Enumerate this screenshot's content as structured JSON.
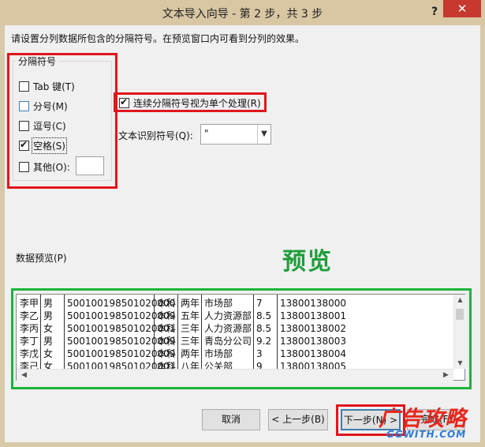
{
  "window": {
    "title": "文本导入向导 - 第 2 步，共 3 步",
    "help_label": "?",
    "close_label": "✕"
  },
  "instruction": "请设置分列数据所包含的分隔符号。在预览窗口内可看到分列的效果。",
  "delimiters": {
    "legend": "分隔符号",
    "tab": {
      "label": "Tab 键(T)",
      "checked": false
    },
    "semicolon": {
      "label": "分号(M)",
      "checked": false
    },
    "comma": {
      "label": "逗号(C)",
      "checked": false
    },
    "space": {
      "label": "空格(S)",
      "checked": true
    },
    "other": {
      "label": "其他(O):",
      "checked": false,
      "value": ""
    }
  },
  "consecutive": {
    "label": "连续分隔符号视为单个处理(R)",
    "checked": true
  },
  "text_qualifier": {
    "label": "文本识别符号(Q):",
    "value": "\""
  },
  "preview": {
    "label": "数据预览(P)",
    "annotation": "预览",
    "rows": [
      [
        "李甲",
        "男",
        "500100198501020000",
        "本科",
        "两年",
        "市场部",
        "7",
        "13800138000"
      ],
      [
        "李乙",
        "男",
        "500100198501020009",
        "本科",
        "五年",
        "人力资源部",
        "8.5",
        "13800138001"
      ],
      [
        "李丙",
        "女",
        "500100198501020001",
        "本科",
        "三年",
        "人力资源部",
        "8.5",
        "13800138002"
      ],
      [
        "李丁",
        "男",
        "500100198501020009",
        "本科",
        "三年",
        "青岛分公司",
        "9.2",
        "13800138003"
      ],
      [
        "李戊",
        "女",
        "500100198501020009",
        "本科",
        "两年",
        "市场部",
        "3",
        "13800138004"
      ],
      [
        "李己",
        "女",
        "500100198501020001",
        "本科",
        "八年",
        "公关部",
        "9",
        "13800138005"
      ]
    ]
  },
  "buttons": {
    "cancel": "取消",
    "back": "< 上一步(B)",
    "next": "下一步(N) >",
    "finish": "完成(F)"
  },
  "watermark": {
    "main": "广告攻略",
    "sub": "GGWITH.COM"
  },
  "colors": {
    "red_frame": "#e0161c",
    "green_frame": "#1db33a",
    "annotation": "#1e9e3a"
  }
}
